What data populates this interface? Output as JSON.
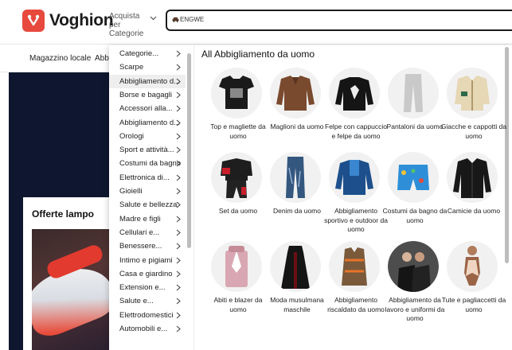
{
  "header": {
    "brand": "Voghion",
    "acquista_line1": "Acquista per",
    "acquista_line2": "Categorie",
    "search_value": "ENGWE"
  },
  "nav": {
    "items": [
      "Magazzino locale",
      "Abbi"
    ]
  },
  "flash": {
    "title": "Offerte lampo"
  },
  "categories": [
    {
      "label": "Categorie...",
      "active": false
    },
    {
      "label": "Scarpe",
      "active": false
    },
    {
      "label": "Abbigliamento d...",
      "active": true
    },
    {
      "label": "Borse e bagagli",
      "active": false
    },
    {
      "label": "Accessori alla...",
      "active": false
    },
    {
      "label": "Abbigliamento d...",
      "active": false
    },
    {
      "label": "Orologi",
      "active": false
    },
    {
      "label": "Sport e attività...",
      "active": false
    },
    {
      "label": "Costumi da bagno",
      "active": false
    },
    {
      "label": "Elettronica di...",
      "active": false
    },
    {
      "label": "Gioielli",
      "active": false
    },
    {
      "label": "Salute e bellezza",
      "active": false
    },
    {
      "label": "Madre e figli",
      "active": false
    },
    {
      "label": "Cellulari e...",
      "active": false
    },
    {
      "label": "Benessere...",
      "active": false
    },
    {
      "label": "Intimo e pigiami",
      "active": false
    },
    {
      "label": "Casa e giardino",
      "active": false
    },
    {
      "label": "Extension e...",
      "active": false
    },
    {
      "label": "Salute e...",
      "active": false
    },
    {
      "label": "Elettrodomestici",
      "active": false
    },
    {
      "label": "Automobili e...",
      "active": false
    }
  ],
  "panel": {
    "title": "All Abbigliamento da uomo",
    "items": [
      {
        "label": "Top e magliette da uomo",
        "icon": "tshirt-image"
      },
      {
        "label": "Maglioni da uomo",
        "icon": "sweater-image"
      },
      {
        "label": "Felpe con cappuccio e felpe da uomo",
        "icon": "sweatshirt-image"
      },
      {
        "label": "Pantaloni da uomo",
        "icon": "pants-image"
      },
      {
        "label": "Giacche e cappotti da uomo",
        "icon": "jacket-image"
      },
      {
        "label": "Set da uomo",
        "icon": "tracksuit-image"
      },
      {
        "label": "Denim da uomo",
        "icon": "jeans-image"
      },
      {
        "label": "Abbigliamento sportivo e outdoor da uomo",
        "icon": "sport-shirt-image"
      },
      {
        "label": "Costumi da bagno da uomo",
        "icon": "swim-shorts-image"
      },
      {
        "label": "Camicie da uomo",
        "icon": "shirt-image"
      },
      {
        "label": "Abiti e blazer da uomo",
        "icon": "suit-image"
      },
      {
        "label": "Moda musulmana maschile",
        "icon": "robe-image"
      },
      {
        "label": "Abbigliamento riscaldato da uomo",
        "icon": "heated-vest-image"
      },
      {
        "label": "Abbigliamento da lavoro e uniformi da uomo",
        "icon": "uniform-image"
      },
      {
        "label": "Tute e pagliaccetti da uomo",
        "icon": "bodysuit-image"
      }
    ]
  },
  "colors": {
    "brand": "#e7493d",
    "hero_bg": "#0f1730",
    "active_row": "#eeeeee"
  }
}
